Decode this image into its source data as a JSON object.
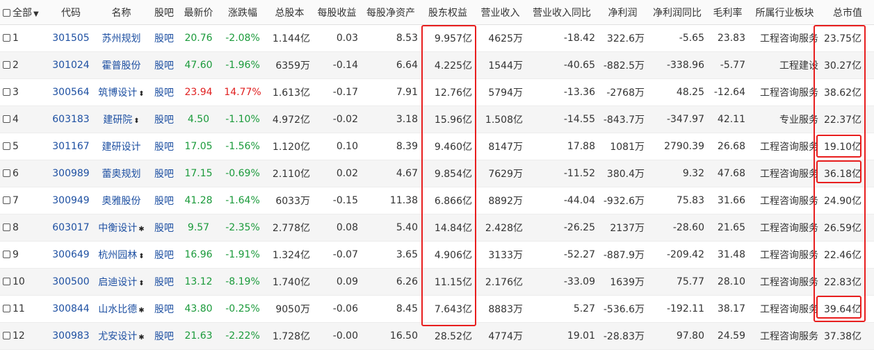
{
  "header": {
    "select_all": "全部",
    "code": "代码",
    "name": "名称",
    "guba": "股吧",
    "price": "最新价",
    "change_pct": "涨跌幅",
    "total_shares": "总股本",
    "eps": "每股收益",
    "navps": "每股净资产",
    "equity": "股东权益",
    "revenue": "营业收入",
    "revenue_yoy": "营业收入同比",
    "net_profit": "净利润",
    "net_profit_yoy": "净利润同比",
    "gross_margin": "毛利率",
    "industry": "所属行业板块",
    "market_cap": "总市值"
  },
  "rows": [
    {
      "idx": "1",
      "code": "301505",
      "name": "苏州规划",
      "mark": "",
      "guba": "股吧",
      "price": "20.76",
      "change": "-2.08%",
      "trend": "down",
      "shares": "1.144亿",
      "eps": "0.03",
      "navps": "8.53",
      "equity": "9.957亿",
      "revenue": "4625万",
      "rev_yoy": "-18.42",
      "profit": "322.6万",
      "profit_yoy": "-5.65",
      "margin": "23.83",
      "industry": "工程咨询服务",
      "mcap": "23.75亿"
    },
    {
      "idx": "2",
      "code": "301024",
      "name": "霍普股份",
      "mark": "",
      "guba": "股吧",
      "price": "47.60",
      "change": "-1.96%",
      "trend": "down",
      "shares": "6359万",
      "eps": "-0.14",
      "navps": "6.64",
      "equity": "4.225亿",
      "revenue": "1544万",
      "rev_yoy": "-40.65",
      "profit": "-882.5万",
      "profit_yoy": "-338.96",
      "margin": "-5.77",
      "industry": "工程建设",
      "mcap": "30.27亿"
    },
    {
      "idx": "3",
      "code": "300564",
      "name": "筑博设计",
      "mark": "⬍",
      "guba": "股吧",
      "price": "23.94",
      "change": "14.77%",
      "trend": "up",
      "shares": "1.613亿",
      "eps": "-0.17",
      "navps": "7.91",
      "equity": "12.76亿",
      "revenue": "5794万",
      "rev_yoy": "-13.36",
      "profit": "-2768万",
      "profit_yoy": "48.25",
      "margin": "-12.64",
      "industry": "工程咨询服务",
      "mcap": "38.62亿"
    },
    {
      "idx": "4",
      "code": "603183",
      "name": "建研院",
      "mark": "⬍",
      "guba": "股吧",
      "price": "4.50",
      "change": "-1.10%",
      "trend": "down",
      "shares": "4.972亿",
      "eps": "-0.02",
      "navps": "3.18",
      "equity": "15.96亿",
      "revenue": "1.508亿",
      "rev_yoy": "-14.55",
      "profit": "-843.7万",
      "profit_yoy": "-347.97",
      "margin": "42.11",
      "industry": "专业服务",
      "mcap": "22.37亿"
    },
    {
      "idx": "5",
      "code": "301167",
      "name": "建研设计",
      "mark": "",
      "guba": "股吧",
      "price": "17.05",
      "change": "-1.56%",
      "trend": "down",
      "shares": "1.120亿",
      "eps": "0.10",
      "navps": "8.39",
      "equity": "9.460亿",
      "revenue": "8147万",
      "rev_yoy": "17.88",
      "profit": "1081万",
      "profit_yoy": "2790.39",
      "margin": "26.68",
      "industry": "工程咨询服务",
      "mcap": "19.10亿"
    },
    {
      "idx": "6",
      "code": "300989",
      "name": "蕾奥规划",
      "mark": "",
      "guba": "股吧",
      "price": "17.15",
      "change": "-0.69%",
      "trend": "down",
      "shares": "2.110亿",
      "eps": "0.02",
      "navps": "4.67",
      "equity": "9.854亿",
      "revenue": "7629万",
      "rev_yoy": "-11.52",
      "profit": "380.4万",
      "profit_yoy": "9.32",
      "margin": "47.68",
      "industry": "工程咨询服务",
      "mcap": "36.18亿"
    },
    {
      "idx": "7",
      "code": "300949",
      "name": "奥雅股份",
      "mark": "",
      "guba": "股吧",
      "price": "41.28",
      "change": "-1.64%",
      "trend": "down",
      "shares": "6033万",
      "eps": "-0.15",
      "navps": "11.38",
      "equity": "6.866亿",
      "revenue": "8892万",
      "rev_yoy": "-44.04",
      "profit": "-932.6万",
      "profit_yoy": "75.83",
      "margin": "31.66",
      "industry": "工程咨询服务",
      "mcap": "24.90亿"
    },
    {
      "idx": "8",
      "code": "603017",
      "name": "中衡设计",
      "mark": "✱",
      "guba": "股吧",
      "price": "9.57",
      "change": "-2.35%",
      "trend": "down",
      "shares": "2.778亿",
      "eps": "0.08",
      "navps": "5.40",
      "equity": "14.84亿",
      "revenue": "2.428亿",
      "rev_yoy": "-26.25",
      "profit": "2137万",
      "profit_yoy": "-28.60",
      "margin": "21.65",
      "industry": "工程咨询服务",
      "mcap": "26.59亿"
    },
    {
      "idx": "9",
      "code": "300649",
      "name": "杭州园林",
      "mark": "⬍",
      "guba": "股吧",
      "price": "16.96",
      "change": "-1.91%",
      "trend": "down",
      "shares": "1.324亿",
      "eps": "-0.07",
      "navps": "3.65",
      "equity": "4.906亿",
      "revenue": "3133万",
      "rev_yoy": "-52.27",
      "profit": "-887.9万",
      "profit_yoy": "-209.42",
      "margin": "31.48",
      "industry": "工程咨询服务",
      "mcap": "22.46亿"
    },
    {
      "idx": "10",
      "code": "300500",
      "name": "启迪设计",
      "mark": "⬍",
      "guba": "股吧",
      "price": "13.12",
      "change": "-8.19%",
      "trend": "down",
      "shares": "1.740亿",
      "eps": "0.09",
      "navps": "6.26",
      "equity": "11.15亿",
      "revenue": "2.176亿",
      "rev_yoy": "-33.09",
      "profit": "1639万",
      "profit_yoy": "75.77",
      "margin": "28.10",
      "industry": "工程咨询服务",
      "mcap": "22.83亿"
    },
    {
      "idx": "11",
      "code": "300844",
      "name": "山水比德",
      "mark": "✱",
      "guba": "股吧",
      "price": "43.80",
      "change": "-0.25%",
      "trend": "down",
      "shares": "9050万",
      "eps": "-0.06",
      "navps": "8.45",
      "equity": "7.643亿",
      "revenue": "8883万",
      "rev_yoy": "5.27",
      "profit": "-536.6万",
      "profit_yoy": "-192.11",
      "margin": "38.17",
      "industry": "工程咨询服务",
      "mcap": "39.64亿"
    },
    {
      "idx": "12",
      "code": "300983",
      "name": "尤安设计",
      "mark": "✱",
      "guba": "股吧",
      "price": "21.63",
      "change": "-2.22%",
      "trend": "down",
      "shares": "1.728亿",
      "eps": "-0.00",
      "navps": "16.50",
      "equity": "28.52亿",
      "revenue": "4774万",
      "rev_yoy": "19.01",
      "profit": "-28.83万",
      "profit_yoy": "97.80",
      "margin": "24.59",
      "industry": "工程咨询服务",
      "mcap": "37.38亿"
    }
  ],
  "colors": {
    "link": "#1e50a2",
    "up": "#e02020",
    "down": "#1a9a3a",
    "highlight_box": "#e81e1e"
  }
}
